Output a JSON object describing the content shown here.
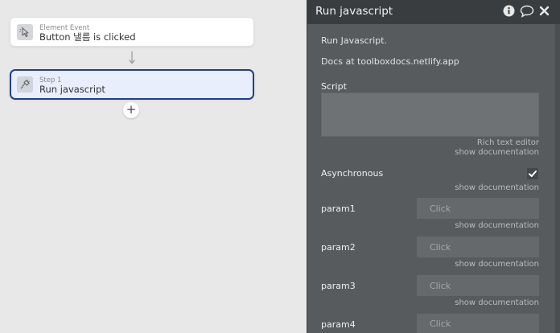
{
  "workflow": {
    "event": {
      "type_label": "Element Event",
      "title": "Button 낼름 is clicked"
    },
    "step": {
      "step_label": "Step 1",
      "title": "Run javascript"
    },
    "add_label": "+"
  },
  "panel": {
    "title": "Run javascript",
    "description": "Run Javascript.",
    "docs": "Docs at toolboxdocs.netlify.app",
    "script_label": "Script",
    "rich_text_link": "Rich text editor",
    "show_documentation": "show documentation",
    "asynchronous_label": "Asynchronous",
    "asynchronous_checked": true,
    "params": [
      {
        "label": "param1",
        "placeholder": "Click"
      },
      {
        "label": "param2",
        "placeholder": "Click"
      },
      {
        "label": "param3",
        "placeholder": "Click"
      },
      {
        "label": "param4",
        "placeholder": "Click"
      }
    ],
    "header_icons": [
      "info-icon",
      "comment-icon",
      "close-icon"
    ]
  },
  "colors": {
    "panel_bg": "#575b5e",
    "header_bg": "#393d3f",
    "step_border": "#233f8c",
    "canvas_bg": "#e8e8e8"
  }
}
